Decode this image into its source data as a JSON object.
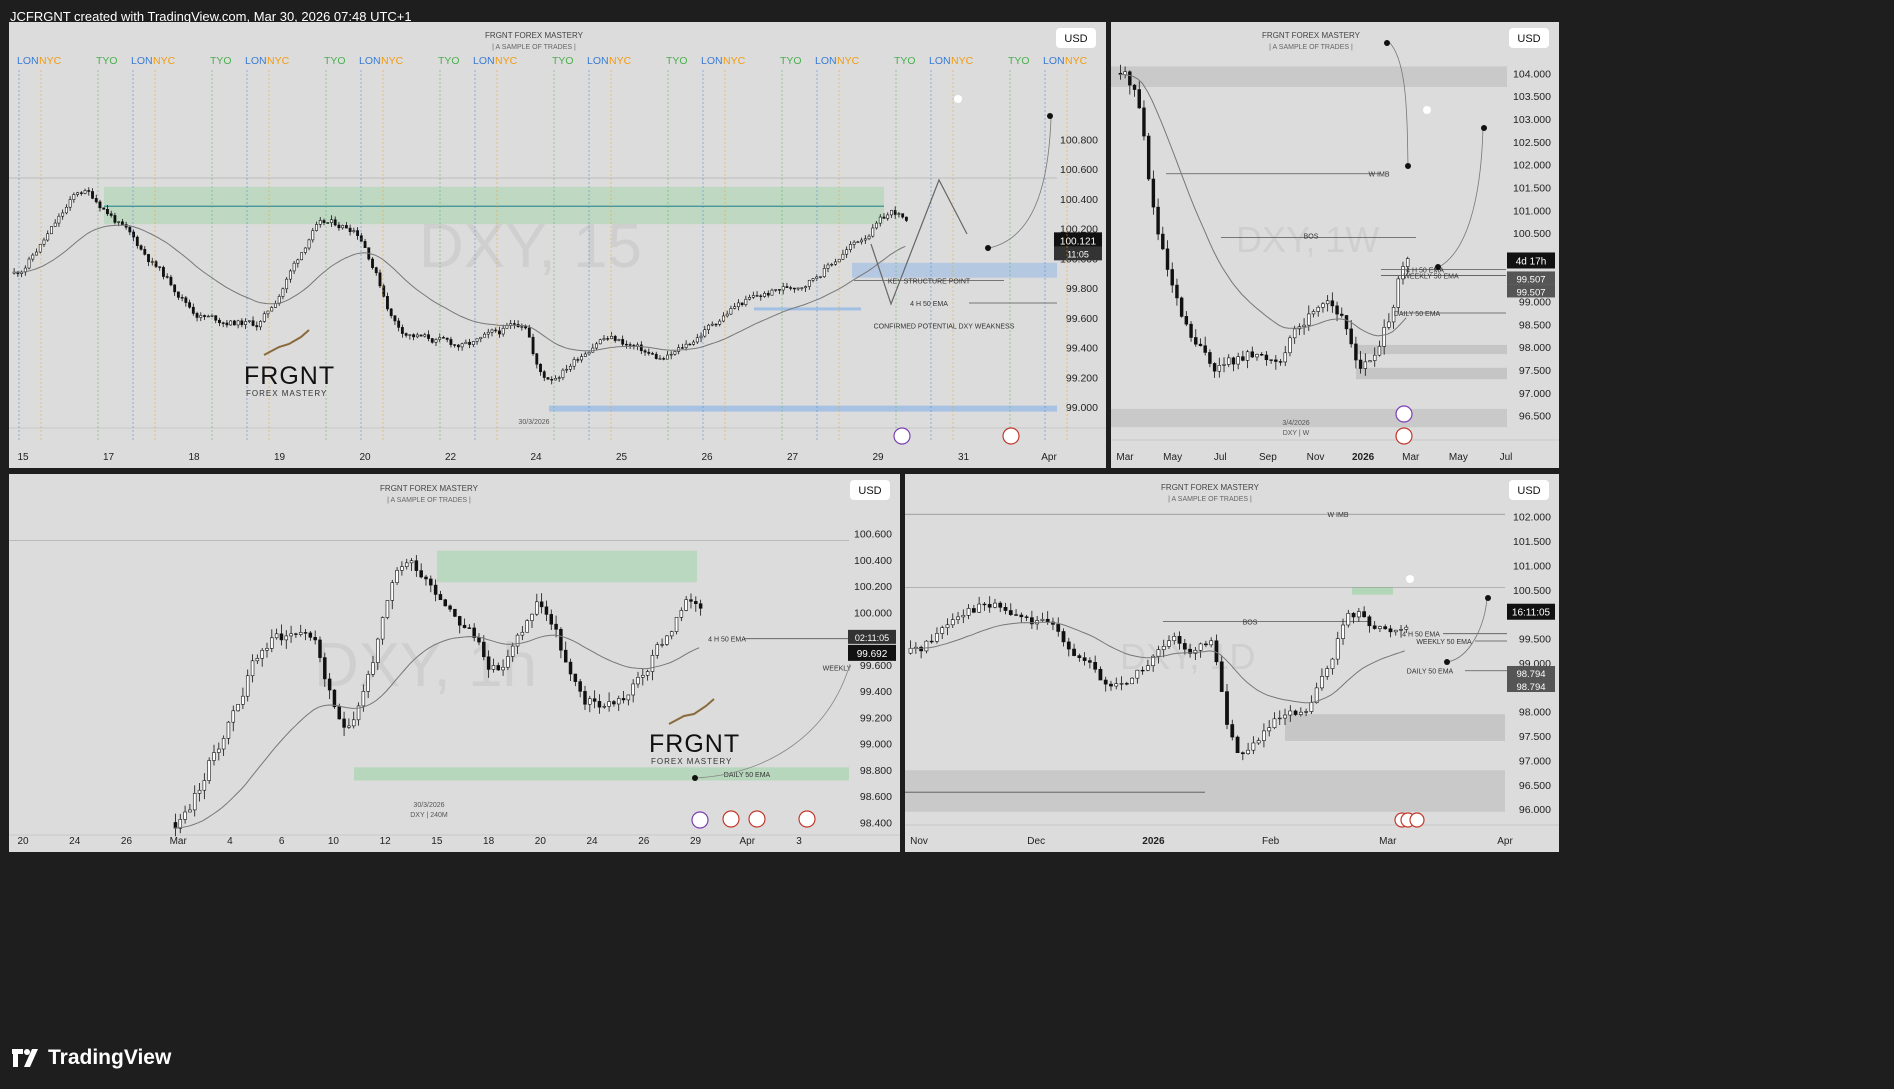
{
  "header": {
    "title": "JCFRGNT created with TradingView.com, Mar 30, 2026 07:48 UTC+1"
  },
  "footer": {
    "brand": "TradingView"
  },
  "colors": {
    "bg": "#1e1e1e",
    "panel": "#dcdcdc",
    "green_zone": "#9fd4a8",
    "blue_zone": "#9bbbe6",
    "candle": "#111111",
    "ema": "#777777"
  },
  "chart_data": [
    {
      "type": "line",
      "symbol": "DXY",
      "timeframe": "15",
      "watermark": "DXY, 15",
      "currency": "USD",
      "title": "FRGNT FOREX MASTERY",
      "subtitle": "| A SAMPLE OF TRADES |",
      "price_ticks": [
        "100.800",
        "100.600",
        "100.400",
        "100.200",
        "100.000",
        "99.800",
        "99.600",
        "99.400",
        "99.200",
        "99.000"
      ],
      "time_ticks": [
        "15",
        "17",
        "18",
        "19",
        "20",
        "22",
        "24",
        "25",
        "26",
        "27",
        "29",
        "31",
        "Apr"
      ],
      "session_labels": [
        "LON",
        "NYC",
        "TYO",
        "LON",
        "NYC",
        "TYO",
        "LON",
        "NYC",
        "TYO",
        "LON",
        "NYC",
        "TYO",
        "LON",
        "NYC",
        "TYO",
        "LON",
        "NYC",
        "TYO",
        "LON",
        "NYC",
        "TYO",
        "LON",
        "NYC",
        "TYO",
        "LON",
        "NYC",
        "TYO",
        "LON",
        "NYC",
        "TYO",
        "TYO"
      ],
      "current_price": "100.121",
      "countdown": "11:05",
      "annotations": [
        "KEY STRUCTURE POINT",
        "4 H 50 EMA",
        "CONFIRMED POTENTIAL DXY WEAKNESS"
      ],
      "date_label": "30/3/2026",
      "ylim": [
        98.9,
        100.95
      ]
    },
    {
      "type": "line",
      "symbol": "DXY",
      "timeframe": "1W",
      "watermark": "DXY, 1W",
      "currency": "USD",
      "title": "FRGNT FOREX MASTERY",
      "subtitle": "| A SAMPLE OF TRADES |",
      "price_ticks": [
        "104.000",
        "103.500",
        "103.000",
        "102.500",
        "102.000",
        "101.500",
        "101.000",
        "100.500",
        "100.000",
        "99.500",
        "99.000",
        "98.500",
        "98.000",
        "97.500",
        "97.000",
        "96.500"
      ],
      "time_ticks": [
        "Mar",
        "May",
        "Jul",
        "Sep",
        "Nov",
        "2026",
        "Mar",
        "May",
        "Jul"
      ],
      "current_price": "4d 17h",
      "price_labels": [
        "99.507",
        "99.507"
      ],
      "annotations": [
        "W IMB",
        "BOS",
        "4 H 50 EMA",
        "WEEKLY 50 EMA",
        "DAILY 50 EMA"
      ],
      "date_label": "3/4/2026",
      "date_sub": "DXY | W",
      "ylim": [
        96.1,
        104.4
      ]
    },
    {
      "type": "line",
      "symbol": "DXY",
      "timeframe": "1h",
      "watermark": "DXY, 1h",
      "currency": "USD",
      "title": "FRGNT FOREX MASTERY",
      "subtitle": "| A SAMPLE OF TRADES |",
      "price_ticks": [
        "100.600",
        "100.400",
        "100.200",
        "100.000",
        "99.800",
        "99.600",
        "99.400",
        "99.200",
        "99.000",
        "98.800",
        "98.600",
        "98.400"
      ],
      "time_ticks": [
        "20",
        "24",
        "26",
        "Mar",
        "4",
        "6",
        "10",
        "12",
        "15",
        "18",
        "20",
        "24",
        "26",
        "29",
        "Apr",
        "3"
      ],
      "current_price": "99.692",
      "countdown": "02:11:05",
      "annotations": [
        "4 H 50 EMA",
        "WEEKLY",
        "DAILY 50 EMA"
      ],
      "date_label": "30/3/2026",
      "date_sub": "DXY | 240M",
      "ylim": [
        98.35,
        100.75
      ]
    },
    {
      "type": "line",
      "symbol": "DXY",
      "timeframe": "1D",
      "watermark": "DXY, 1D",
      "currency": "USD",
      "title": "FRGNT FOREX MASTERY",
      "subtitle": "| A SAMPLE OF TRADES |",
      "price_ticks": [
        "102.000",
        "101.500",
        "101.000",
        "100.500",
        "100.000",
        "99.500",
        "99.000",
        "98.500",
        "98.000",
        "97.500",
        "97.000",
        "96.500",
        "96.000"
      ],
      "time_ticks": [
        "Nov",
        "Dec",
        "2026",
        "Feb",
        "Mar",
        "Apr"
      ],
      "current_price": "16:11:05",
      "price_labels": [
        "98.794",
        "98.794"
      ],
      "annotations": [
        "W IMB",
        "BOS",
        "4 H 50 EMA",
        "WEEKLY 50 EMA",
        "DAILY 50 EMA"
      ],
      "ylim": [
        95.8,
        102.3
      ]
    }
  ]
}
